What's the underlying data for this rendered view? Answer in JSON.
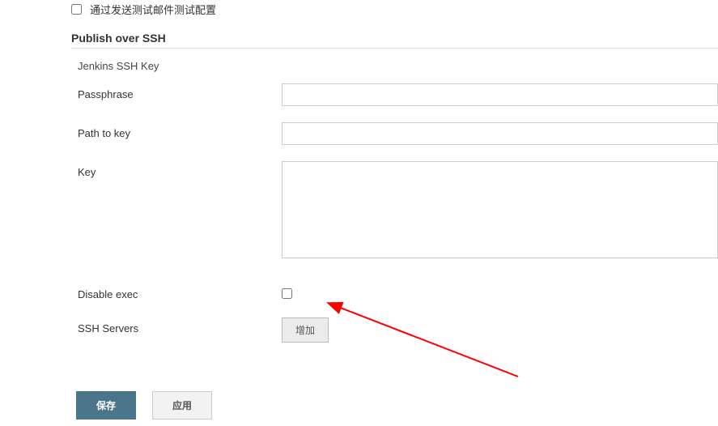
{
  "topCheckbox": {
    "label": "通过发送测试邮件测试配置"
  },
  "section": {
    "title": "Publish over SSH"
  },
  "jenkinsKey": {
    "label": "Jenkins SSH Key"
  },
  "fields": {
    "passphrase": {
      "label": "Passphrase",
      "value": ""
    },
    "pathToKey": {
      "label": "Path to key",
      "value": ""
    },
    "key": {
      "label": "Key",
      "value": ""
    },
    "disableExec": {
      "label": "Disable exec"
    },
    "sshServers": {
      "label": "SSH Servers"
    }
  },
  "buttons": {
    "add": "增加",
    "save": "保存",
    "apply": "应用"
  }
}
